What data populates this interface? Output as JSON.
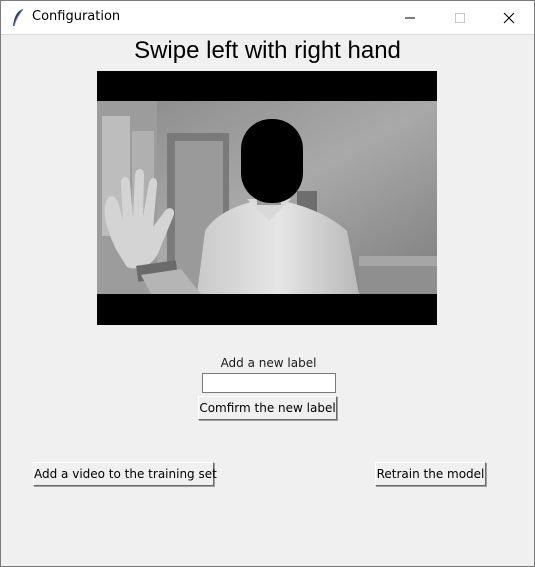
{
  "window": {
    "title": "Configuration",
    "icon": "feather-icon"
  },
  "heading": "Swipe left with right hand",
  "video": {
    "description_icon": "webcam-frame"
  },
  "form": {
    "caption": "Add a new label",
    "input_value": "",
    "confirm_label": "Comfirm the new label"
  },
  "actions": {
    "add_video_label": "Add a video to the training set",
    "retrain_label": "Retrain the model"
  }
}
